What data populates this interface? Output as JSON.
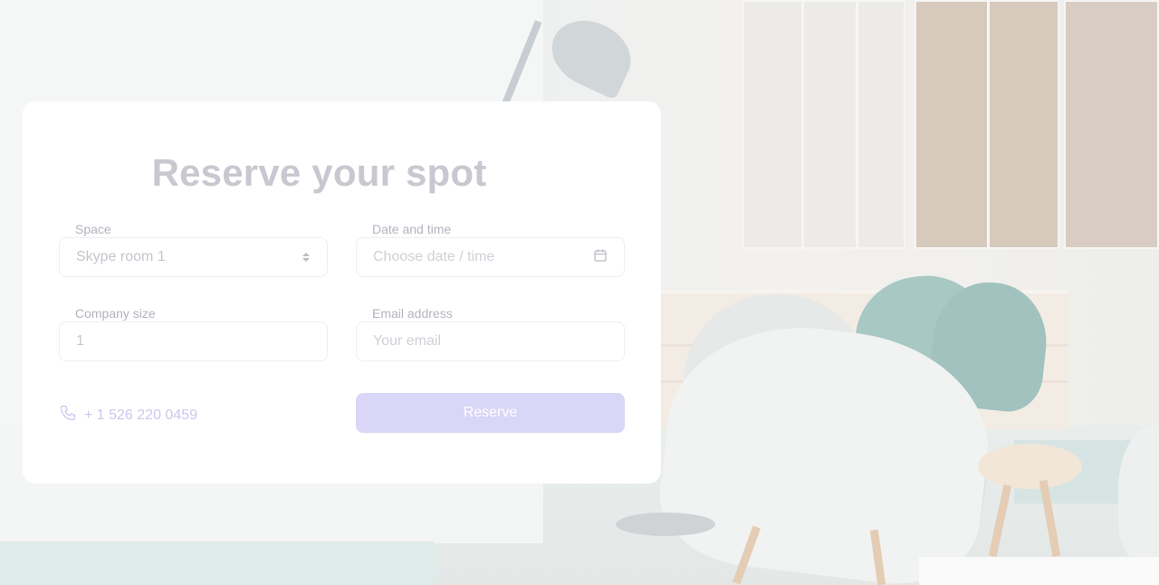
{
  "form": {
    "title": "Reserve your spot",
    "space": {
      "label": "Space",
      "selected": "Skype room 1"
    },
    "datetime": {
      "label": "Date and time",
      "placeholder": "Choose date / time"
    },
    "company_size": {
      "label": "Company size",
      "value": "1"
    },
    "email": {
      "label": "Email address",
      "placeholder": "Your email"
    },
    "phone": "+ 1 526 220 0459",
    "reserve_label": "Reserve"
  },
  "icons": {
    "phone": "phone-icon",
    "calendar": "calendar-icon",
    "select": "select-arrows-icon"
  },
  "colors": {
    "accent": "#d9d6f7",
    "title": "#c9c8d1",
    "phone_text": "#c9c7ef",
    "card": "#ffffff"
  }
}
